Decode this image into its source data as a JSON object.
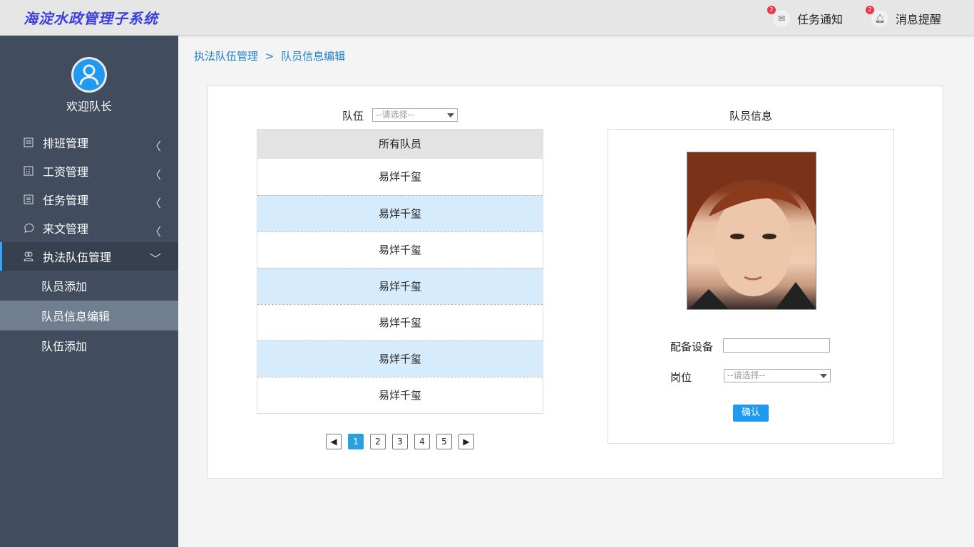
{
  "header": {
    "title": "海淀水政管理子系统",
    "tasks": {
      "label": "任务通知",
      "badge": "2",
      "icon": "mail-icon"
    },
    "messages": {
      "label": "消息提醒",
      "badge": "2",
      "icon": "bell-icon"
    }
  },
  "sidebar": {
    "welcome": "欢迎队长",
    "menu": [
      {
        "label": "排班管理",
        "icon": "list-icon"
      },
      {
        "label": "工资管理",
        "icon": "calendar-icon"
      },
      {
        "label": "任务管理",
        "icon": "document-icon"
      },
      {
        "label": "来文管理",
        "icon": "chat-icon"
      },
      {
        "label": "执法队伍管理",
        "icon": "users-icon"
      }
    ],
    "submenu": [
      "队员添加",
      "队员信息编辑",
      "队伍添加"
    ]
  },
  "breadcrumb": {
    "parent": "执法队伍管理",
    "separator": ">",
    "current": "队员信息编辑"
  },
  "team_filter": {
    "label": "队伍",
    "placeholder": "--请选择--"
  },
  "table": {
    "header": "所有队员",
    "rows": [
      "易烊千玺",
      "易烊千玺",
      "易烊千玺",
      "易烊千玺",
      "易烊千玺",
      "易烊千玺",
      "易烊千玺"
    ]
  },
  "pager": {
    "pages": [
      "1",
      "2",
      "3",
      "4",
      "5"
    ],
    "current": "1"
  },
  "member_info": {
    "title": "队员信息",
    "equipment_label": "配备设备",
    "equipment_value": "",
    "post_label": "岗位",
    "post_placeholder": "--请选择--",
    "confirm": "确认"
  },
  "colors": {
    "accent": "#1e9bf0",
    "sidebar": "#414d5f",
    "row_alt": "#d6ebfb"
  }
}
